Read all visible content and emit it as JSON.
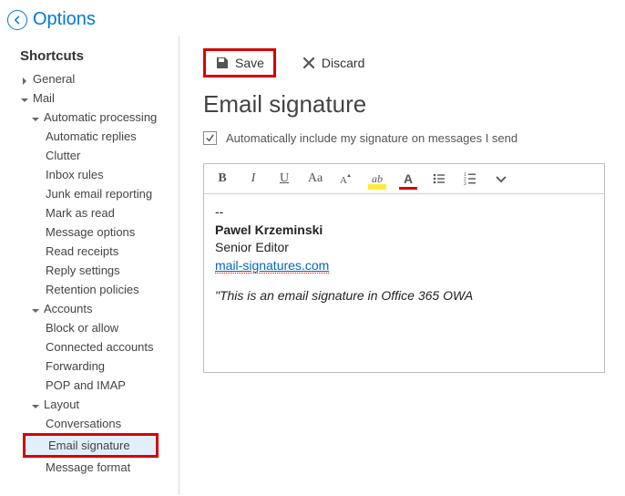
{
  "header": {
    "title": "Options"
  },
  "sidebar": {
    "heading": "Shortcuts",
    "items": {
      "general": "General",
      "mail": "Mail",
      "auto_processing": "Automatic processing",
      "auto_replies": "Automatic replies",
      "clutter": "Clutter",
      "inbox_rules": "Inbox rules",
      "junk": "Junk email reporting",
      "mark_read": "Mark as read",
      "msg_options": "Message options",
      "read_receipts": "Read receipts",
      "reply_settings": "Reply settings",
      "retention": "Retention policies",
      "accounts": "Accounts",
      "block_allow": "Block or allow",
      "connected": "Connected accounts",
      "forwarding": "Forwarding",
      "pop_imap": "POP and IMAP",
      "layout": "Layout",
      "conversations": "Conversations",
      "email_sig": "Email signature",
      "msg_format": "Message format"
    }
  },
  "toolbar": {
    "save": "Save",
    "discard": "Discard"
  },
  "page": {
    "title": "Email signature",
    "checkbox_label": "Automatically include my signature on messages I send"
  },
  "signature": {
    "sep": "--",
    "name": "Pawel Krzeminski",
    "title": "Senior Editor",
    "link": "mail-signatures.com",
    "quote": "\"This is an email signature in Office 365 OWA"
  }
}
